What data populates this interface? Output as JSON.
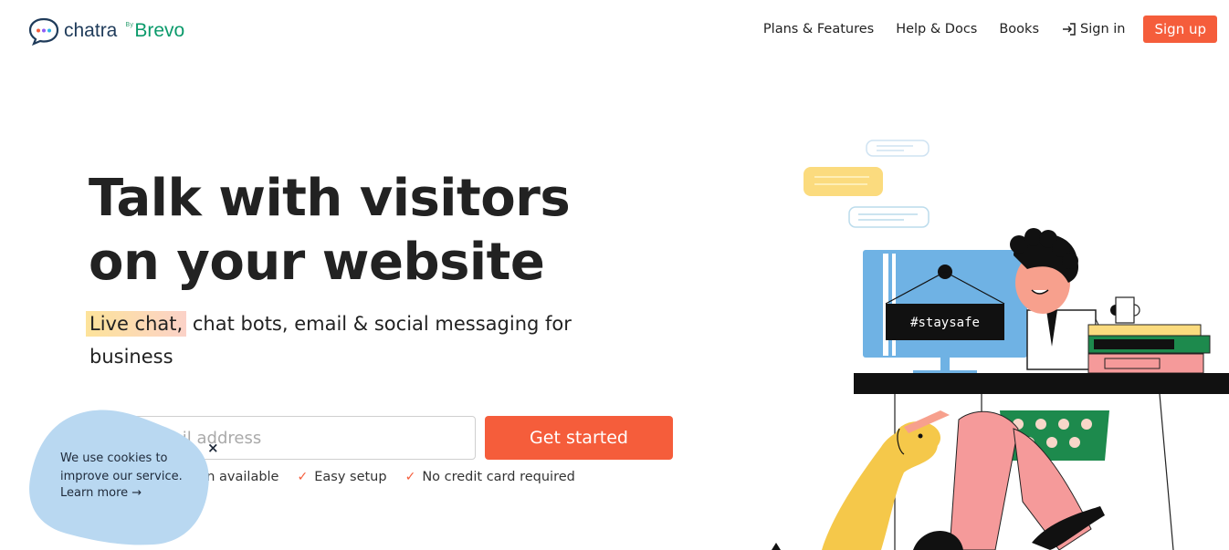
{
  "header": {
    "logo_text": "chatra",
    "logo_by": "By",
    "logo_partner": "Brevo",
    "nav": [
      "Plans & Features",
      "Help & Docs",
      "Books"
    ],
    "signin_label": "Sign in",
    "signup_label": "Sign up"
  },
  "hero": {
    "headline_line1": "Talk with visitors",
    "headline_line2": "on your website",
    "sub_highlight": "Live chat,",
    "sub_rest": " chat bots, email & social messaging for business",
    "email_placeholder": "Your email address",
    "cta_label": "Get started",
    "features": [
      "Free plan available",
      "Easy setup",
      "No credit card required"
    ]
  },
  "cookie": {
    "text": "We use cookies to improve our service.",
    "learn_more": "Learn more →",
    "close": "×"
  },
  "illustration": {
    "sign_text": "#staysafe"
  },
  "colors": {
    "accent": "#f55d3b",
    "brand": "#1f3b5a",
    "partner": "#0b9a6b",
    "cookie_bg": "#b9d8f1"
  }
}
